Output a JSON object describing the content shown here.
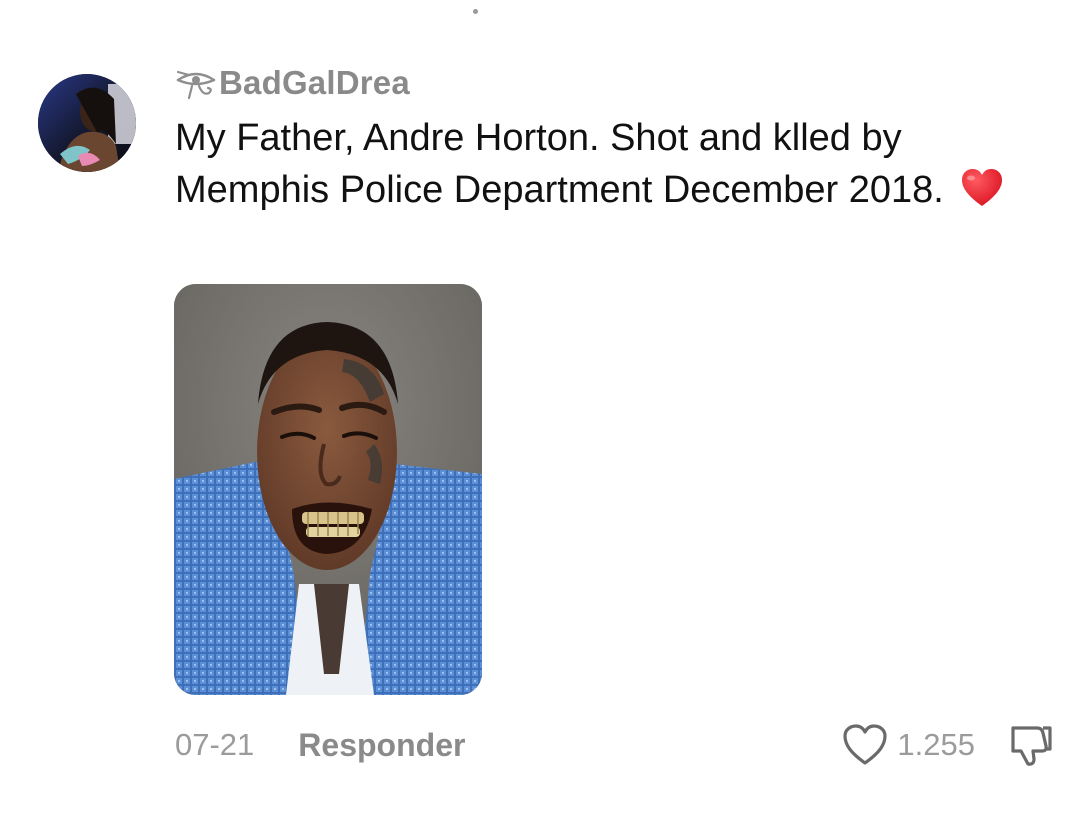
{
  "comment": {
    "username": "BadGalDrea",
    "username_badge_icon": "eye-of-horus-icon",
    "text": "My Father, Andre Horton. Shot and klled by Memphis Police Department December 2018.",
    "text_emoji": "red-heart-emoji",
    "date": "07-21",
    "reply_label": "Responder",
    "like_count": "1.255",
    "like_icon": "heart-outline-icon",
    "dislike_icon": "thumbs-down-icon"
  },
  "colors": {
    "text_primary": "#111111",
    "text_muted": "#8e8e8e",
    "emoji_red": "#e0202e",
    "background": "#ffffff"
  }
}
